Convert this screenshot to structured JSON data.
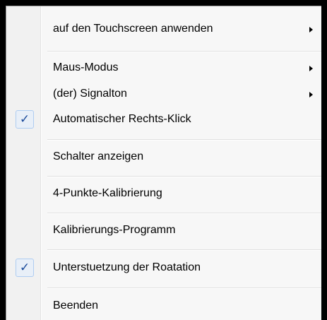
{
  "menu": {
    "items": [
      {
        "label": "auf den Touchscreen anwenden",
        "submenu": true,
        "checked": false
      },
      {
        "label": "Maus-Modus",
        "submenu": true,
        "checked": false
      },
      {
        "label": "(der) Signalton",
        "submenu": true,
        "checked": false
      },
      {
        "label": "Automatischer Rechts-Klick",
        "submenu": false,
        "checked": true
      },
      {
        "label": "Schalter anzeigen",
        "submenu": false,
        "checked": false
      },
      {
        "label": "4-Punkte-Kalibrierung",
        "submenu": false,
        "checked": false
      },
      {
        "label": "Kalibrierungs-Programm",
        "submenu": false,
        "checked": false
      },
      {
        "label": "Unterstuetzung der Roatation",
        "submenu": false,
        "checked": true
      },
      {
        "label": "Beenden",
        "submenu": false,
        "checked": false
      }
    ],
    "check_glyph": "✓",
    "colors": {
      "background": "#f7f7f7",
      "check_box_fill": "#e8eff8",
      "check_box_border": "#aeccf1",
      "check_mark": "#1a4a9a"
    }
  }
}
